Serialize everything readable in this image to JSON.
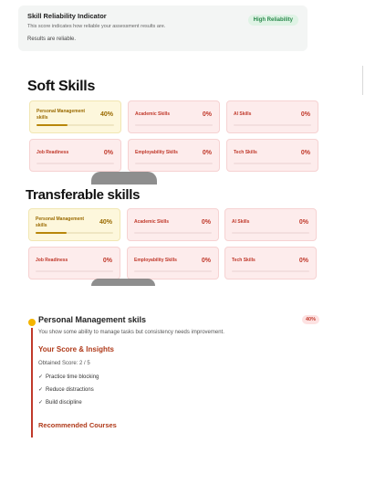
{
  "reliability": {
    "title": "Skill Reliability Indicator",
    "subtitle": "This score indicates how reliable your assessment results are.",
    "status": "Results are reliable.",
    "badge": "High Reliability"
  },
  "soft_skills": {
    "title": "Soft Skills",
    "cards": [
      {
        "label": "Personal Management skills",
        "pct": "40%",
        "progress": 0.4
      },
      {
        "label": "Academic Skills",
        "pct": "0%",
        "progress": 0
      },
      {
        "label": "AI Skills",
        "pct": "0%",
        "progress": 0
      },
      {
        "label": "Job Readiness",
        "pct": "0%",
        "progress": 0
      },
      {
        "label": "Employability Skills",
        "pct": "0%",
        "progress": 0
      },
      {
        "label": "Tech Skills",
        "pct": "0%",
        "progress": 0
      }
    ]
  },
  "transferable_skills": {
    "title": "Transferable skills",
    "cards": [
      {
        "label": "Personal Management skills",
        "pct": "40%",
        "progress": 0.4
      },
      {
        "label": "Academic Skills",
        "pct": "0%",
        "progress": 0
      },
      {
        "label": "AI Skills",
        "pct": "0%",
        "progress": 0
      },
      {
        "label": "Job Readiness",
        "pct": "0%",
        "progress": 0
      },
      {
        "label": "Employability Skills",
        "pct": "0%",
        "progress": 0
      },
      {
        "label": "Tech Skills",
        "pct": "0%",
        "progress": 0
      }
    ]
  },
  "detail": {
    "title": "Personal Management skils",
    "badge": "40%",
    "description": "You show some ability to manage tasks but consistency needs improvement.",
    "insights_title": "Your Score & Insights",
    "score": "Obtained Score: 2 / 5",
    "tips": [
      "Practice time blocking",
      "Reduce distractions",
      "Build discipline"
    ],
    "courses_title": "Recommended Courses"
  },
  "colors": {
    "accent": "#c0392b",
    "highlight_card": "#fdf7dc",
    "default_card": "#fdecec",
    "reliability_badge": "#dff3e5"
  }
}
